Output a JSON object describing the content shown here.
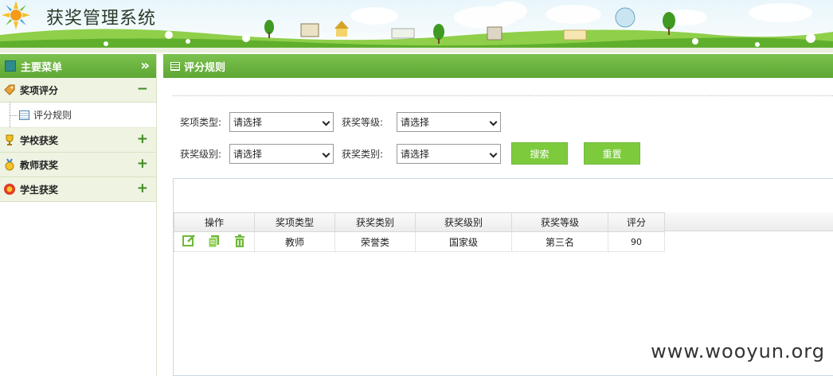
{
  "header": {
    "app_title": "获奖管理系统"
  },
  "sidebar": {
    "title": "主要菜单",
    "groups": [
      {
        "label": "奖项评分",
        "toggle": "−",
        "items": [
          {
            "label": "评分规则"
          }
        ]
      },
      {
        "label": "学校获奖",
        "toggle": "+"
      },
      {
        "label": "教师获奖",
        "toggle": "+"
      },
      {
        "label": "学生获奖",
        "toggle": "+"
      }
    ]
  },
  "main": {
    "title": "评分规则",
    "filters": {
      "award_type": {
        "label": "奖项类型:",
        "value": "请选择"
      },
      "award_rank": {
        "label": "获奖等级:",
        "value": "请选择"
      },
      "award_level": {
        "label": "获奖级别:",
        "value": "请选择"
      },
      "award_category": {
        "label": "获奖类别:",
        "value": "请选择"
      }
    },
    "buttons": {
      "search": "搜索",
      "reset": "重置"
    },
    "table": {
      "columns": [
        "操作",
        "奖项类型",
        "获奖类别",
        "获奖级别",
        "获奖等级",
        "评分"
      ],
      "rows": [
        {
          "type": "教师",
          "category": "荣誉类",
          "level": "国家级",
          "rank": "第三名",
          "score": "90"
        }
      ]
    }
  },
  "watermark": "www.wooyun.org",
  "colors": {
    "accent_green": "#6db83a",
    "header_green": "#5ea734",
    "button_green": "#7dcb3d"
  }
}
